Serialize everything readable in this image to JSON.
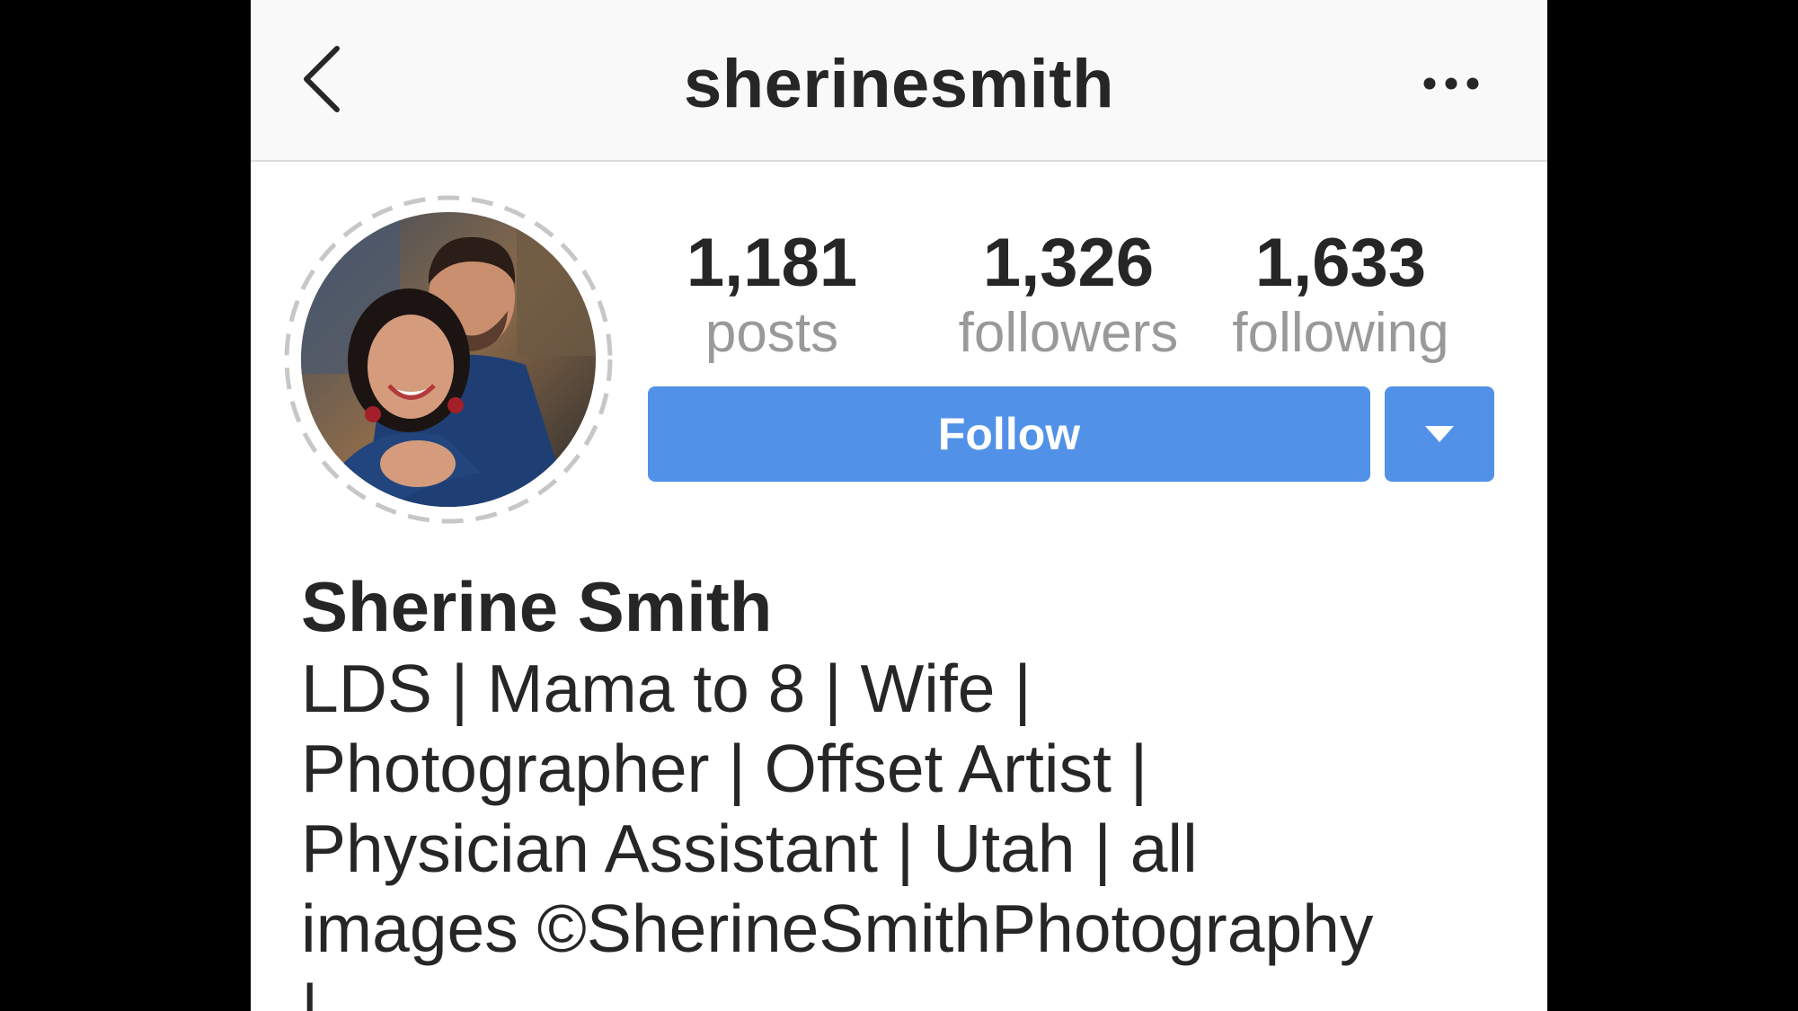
{
  "header": {
    "title": "sherinesmith",
    "back_icon": "chevron-left-icon",
    "more_icon": "more-horizontal-icon"
  },
  "profile": {
    "avatar": "profile-photo",
    "stats": {
      "posts": {
        "value": "1,181",
        "label": "posts"
      },
      "followers": {
        "value": "1,326",
        "label": "followers"
      },
      "following": {
        "value": "1,633",
        "label": "following"
      }
    },
    "follow_label": "Follow",
    "dropdown_icon": "triangle-down-icon",
    "name": "Sherine Smith",
    "bio_lines": [
      "LDS | Mama to 8 | Wife |",
      "Photographer | Offset Artist |",
      "Physician Assistant | Utah | all",
      "images ©SherineSmithPhotography",
      "|"
    ]
  },
  "colors": {
    "accent": "#5192e8",
    "text": "#262626",
    "secondary_text": "#999999",
    "header_bg": "#f9f9f9"
  }
}
